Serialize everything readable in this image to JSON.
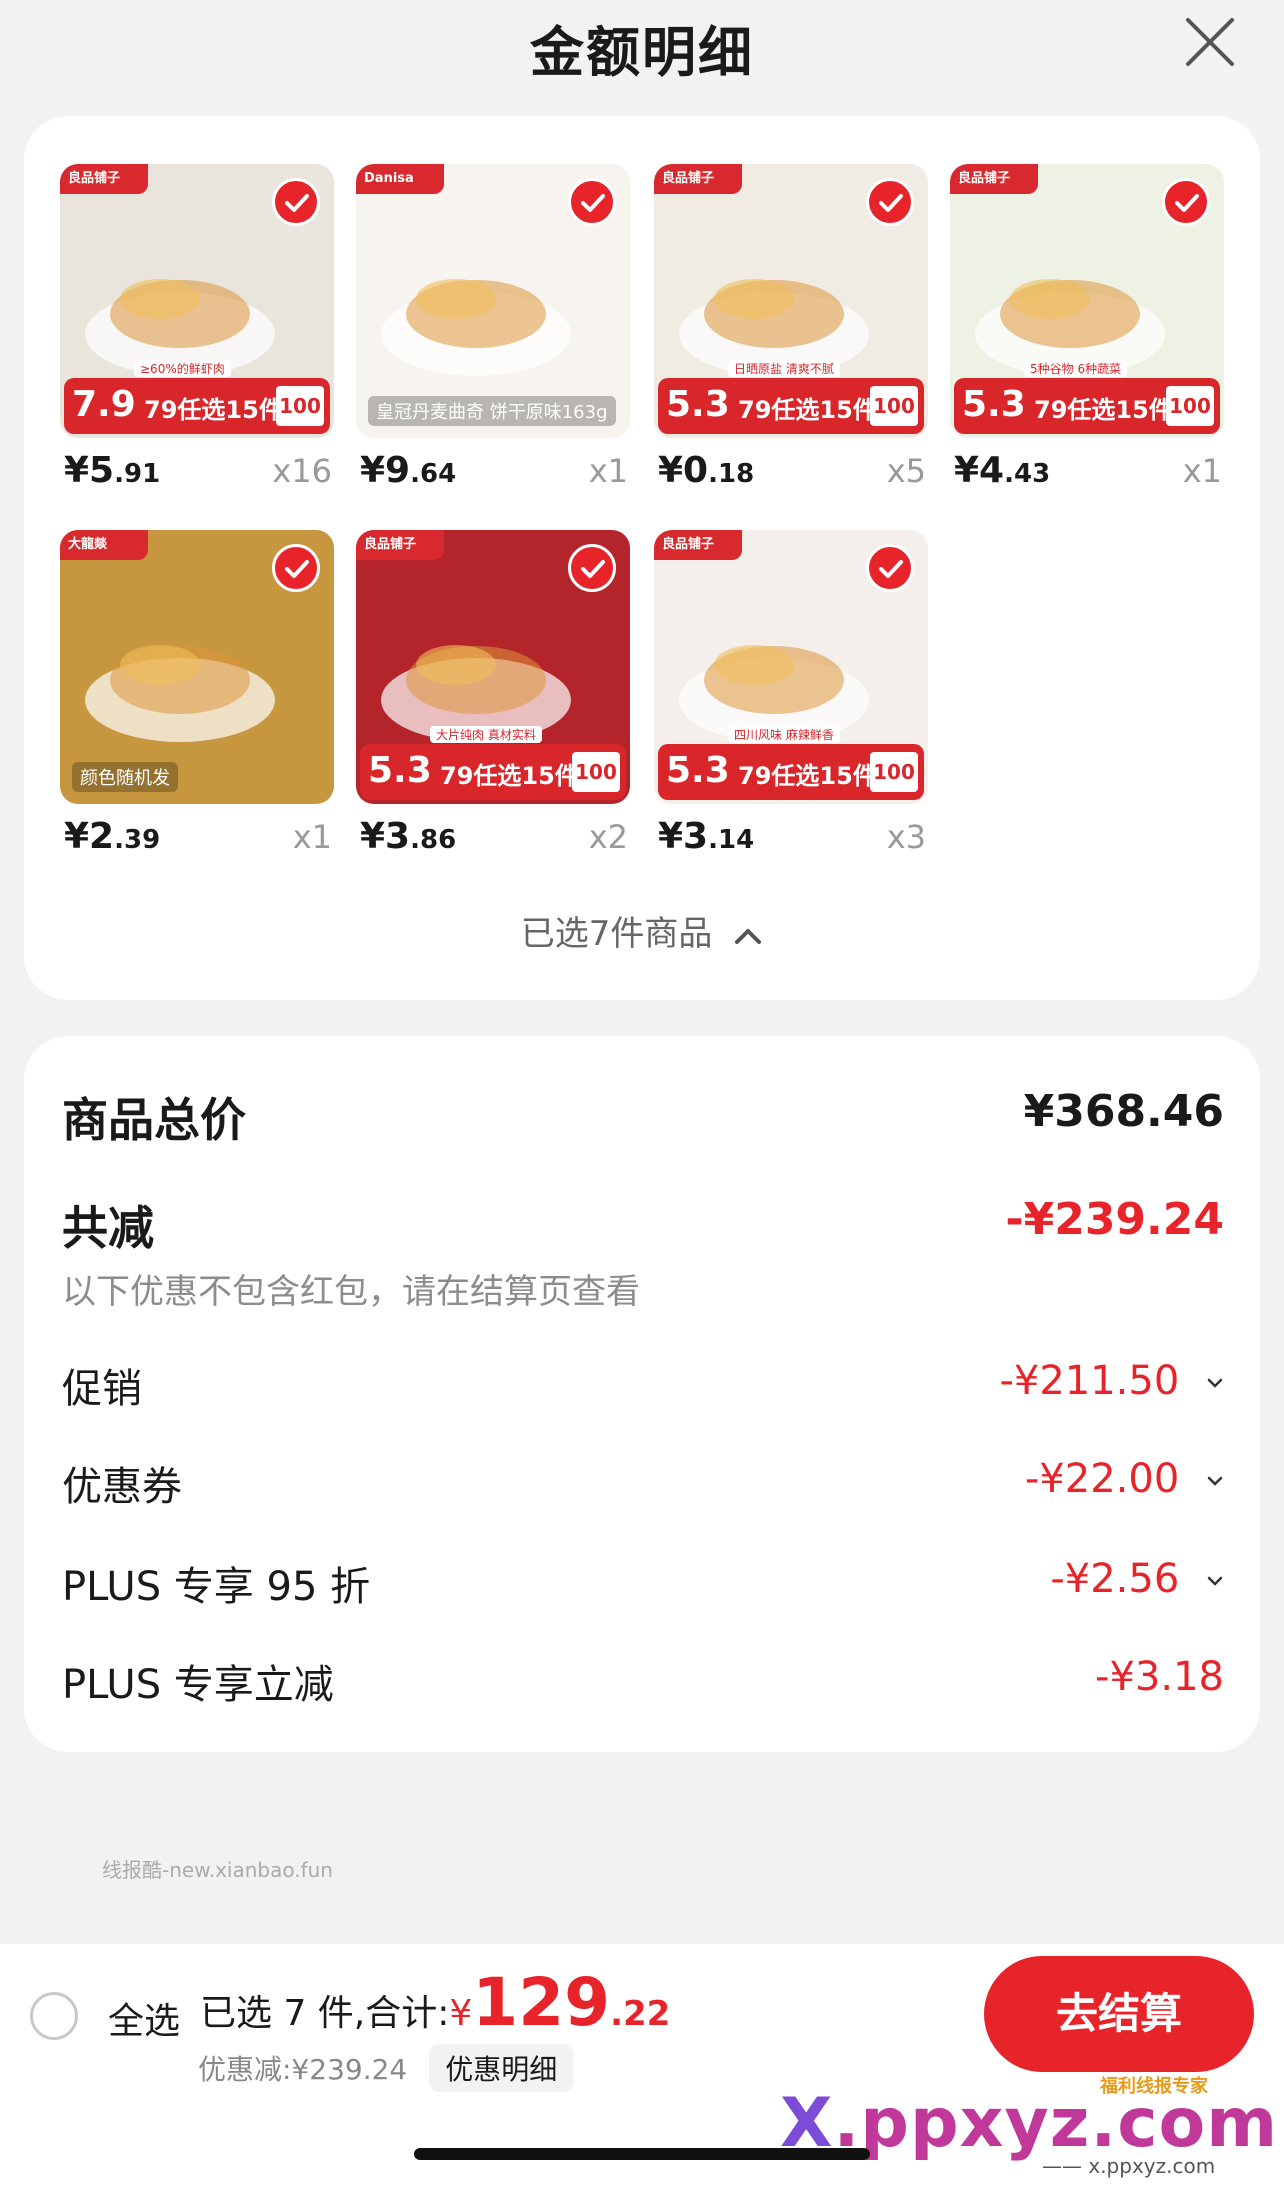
{
  "header": {
    "title": "金额明细",
    "close_icon": "close-icon"
  },
  "products": [
    {
      "brand": "良品铺子",
      "badge": "7.9",
      "promo": "79任选15件",
      "note": "≥60%的鲜虾肉",
      "box": "100",
      "price_int": "¥5",
      "price_dec": ".91",
      "qty": "x16",
      "bg": "#e9e4dc"
    },
    {
      "brand": "Danisa",
      "badge": "",
      "promo": "",
      "note": "皇冠丹麦曲奇 饼干原味163g",
      "box": "",
      "price_int": "¥9",
      "price_dec": ".64",
      "qty": "x1",
      "bg": "#f7f3ee"
    },
    {
      "brand": "良品铺子",
      "badge": "5.3",
      "promo": "79任选15件",
      "note": "日晒原盐 清爽不腻",
      "box": "100",
      "price_int": "¥0",
      "price_dec": ".18",
      "qty": "x5",
      "bg": "#f1ece3"
    },
    {
      "brand": "良品铺子",
      "badge": "5.3",
      "promo": "79任选15件",
      "note": "5种谷物 6种蔬菜",
      "box": "100",
      "price_int": "¥4",
      "price_dec": ".43",
      "qty": "x1",
      "bg": "#eef2e4"
    },
    {
      "brand": "大龍燚",
      "badge": "",
      "promo": "",
      "note": "颜色随机发",
      "box": "",
      "price_int": "¥2",
      "price_dec": ".39",
      "qty": "x1",
      "bg": "#c7973f"
    },
    {
      "brand": "良品铺子",
      "badge": "5.3",
      "promo": "79任选15件",
      "note": "大片纯肉 真材实料",
      "box": "100",
      "price_int": "¥3",
      "price_dec": ".86",
      "qty": "x2",
      "bg": "#b3252a"
    },
    {
      "brand": "良品铺子",
      "badge": "5.3",
      "promo": "79任选15件",
      "note": "四川风味 麻辣鲜香",
      "box": "100",
      "price_int": "¥3",
      "price_dec": ".14",
      "qty": "x3",
      "bg": "#f4efea"
    }
  ],
  "selected_summary": "已选7件商品",
  "summary": {
    "total_label": "商品总价",
    "total_value": "¥368.46",
    "reduce_label": "共减",
    "reduce_value": "-¥239.24",
    "note": "以下优惠不包含红包，请在结算页查看",
    "rows": [
      {
        "label": "促销",
        "value": "-¥211.50"
      },
      {
        "label": "优惠券",
        "value": "-¥22.00"
      },
      {
        "label": "PLUS 专享 95 折",
        "value": "-¥2.56"
      },
      {
        "label": "PLUS 专享立减",
        "value": "-¥3.18"
      }
    ]
  },
  "watermark": "线报酷-new.xianbao.fun",
  "bottom": {
    "select_all": "全选",
    "selected_prefix": "已选 7 件,合计:",
    "currency": "¥",
    "total_int": "129",
    "total_dec": ".22",
    "discount": "优惠减:¥239.24",
    "detail_btn": "优惠明细",
    "checkout_btn": "去结算"
  },
  "logo": {
    "main_x": "X",
    "main_rest": ".ppxyz.com",
    "sub": "—— x.ppxyz.com ——",
    "badge": "福利线报专家"
  },
  "colors": {
    "accent": "#e8242b",
    "background": "#f2f2f2",
    "card": "#ffffff"
  }
}
